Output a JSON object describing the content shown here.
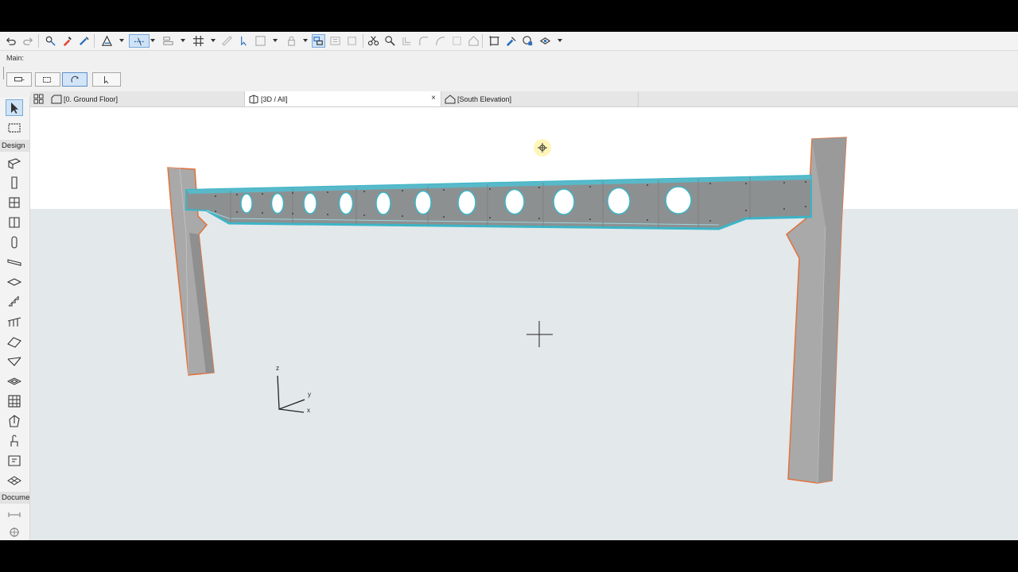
{
  "toolbar": {
    "icons": [
      "undo-icon",
      "redo-icon",
      "pet-palette-icon",
      "eyedropper-icon",
      "injection-icon",
      "trace-icon",
      "snap-guide-icon",
      "align-icon",
      "grid-snap-icon",
      "ruler-icon",
      "select-icon",
      "group-icon",
      "lock-icon",
      "suspend-group-icon",
      "magic-wand-icon",
      "adjust-icon",
      "split-icon",
      "intersect-icon",
      "offset-icon",
      "fillet-icon",
      "resize-icon",
      "roof-trim-icon",
      "cut-icon",
      "explode-icon",
      "renovation-icon",
      "graphic-override-icon"
    ]
  },
  "infobox": {
    "title": "Main:"
  },
  "toolbox": {
    "design_label": "Design",
    "document_label": "Docume",
    "design_tools": [
      "wall-tool",
      "column-tool",
      "beam-tool",
      "window-tool",
      "door-tool",
      "object-tool",
      "slab-tool",
      "stair-tool",
      "railing-tool",
      "roof-tool",
      "shell-tool",
      "skylight-tool",
      "curtain-wall-tool",
      "morph-tool",
      "zone-tool",
      "mesh-tool",
      "stair-tool-2",
      "terrain-tool"
    ],
    "document_tools": [
      "dimension-tool",
      "level-dimension-tool"
    ]
  },
  "tabs": [
    {
      "label": "[0. Ground Floor]",
      "icon": "floor-plan-icon",
      "active": false
    },
    {
      "label": "[3D / All]",
      "icon": "3d-view-icon",
      "active": true,
      "close": "×"
    },
    {
      "label": "[South Elevation]",
      "icon": "elevation-icon",
      "active": false
    }
  ],
  "viewport": {
    "axes": {
      "z": "z",
      "y": "y",
      "x": "x"
    },
    "colors": {
      "background_top": "#ffffff",
      "ground": "#e3e8ea",
      "column_fill": "#a8a8a8",
      "column_edge": "#e0723c",
      "beam_fill": "#8c8f90",
      "beam_highlight": "#3bb5c7"
    }
  }
}
